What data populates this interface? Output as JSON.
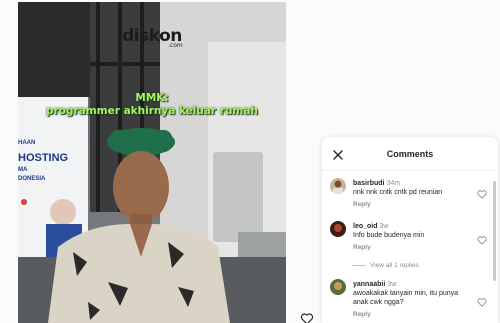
{
  "video": {
    "watermark": "diskon",
    "watermark_sub": ".com",
    "caption_line1": "MMK:",
    "caption_line2": "programmer akhirnya keluar rumah",
    "banner_line1": "HAAN",
    "banner_line2": "HOSTING",
    "banner_line3": "MA",
    "banner_line4": "DONESIA"
  },
  "comments_panel": {
    "title": "Comments",
    "comments": [
      {
        "username": "basirbudi",
        "time": "34m",
        "text": "nnk nnk cntk cntk pd reunian",
        "reply_label": "Reply"
      },
      {
        "username": "leo_oid",
        "time": "3w",
        "text": "Info bude budenya min",
        "reply_label": "Reply"
      },
      {
        "username": "yannaabii",
        "time": "3w",
        "text": "awoakakak tanyain min, itu punya anak cwk ngga?",
        "reply_label": "Reply"
      }
    ],
    "view_replies_label": "View all 1 replies"
  },
  "colors": {
    "caption": "#a8f06a",
    "text": "#262626",
    "muted": "#8e8e8e"
  },
  "icons": {
    "close": "close-icon",
    "like": "heart-outline-icon",
    "post_like": "heart-outline-icon"
  }
}
